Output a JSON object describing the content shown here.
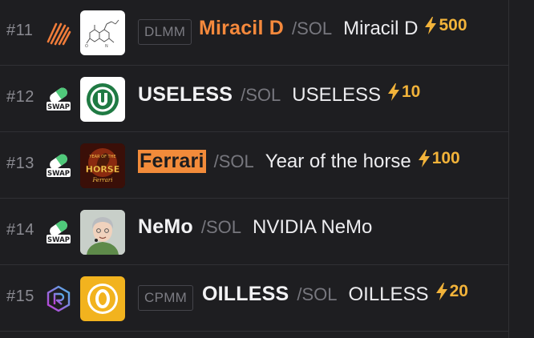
{
  "rows": [
    {
      "rank": "#11",
      "dex": "meteora",
      "pool": "DLMM",
      "symbol": "Miracil D",
      "pair": "/SOL",
      "name": "Miracil D",
      "boost": "500"
    },
    {
      "rank": "#12",
      "dex": "pumpswap",
      "dex_label": "SWAP",
      "pool": "",
      "symbol": "USELESS",
      "pair": "/SOL",
      "name": "USELESS",
      "boost": "10"
    },
    {
      "rank": "#13",
      "dex": "pumpswap",
      "dex_label": "SWAP",
      "pool": "",
      "symbol": "Ferrari",
      "pair": "/SOL",
      "name": "Year of the horse",
      "boost": "100",
      "logo_text": [
        "YEAR OF THE",
        "HORSE",
        "Ferrari"
      ]
    },
    {
      "rank": "#14",
      "dex": "pumpswap",
      "dex_label": "SWAP",
      "pool": "",
      "symbol": "NeMo",
      "pair": "/SOL",
      "name": "NVIDIA NeMo",
      "boost": ""
    },
    {
      "rank": "#15",
      "dex": "raydium",
      "pool": "CPMM",
      "symbol": "OILLESS",
      "pair": "/SOL",
      "name": "OILLESS",
      "boost": "20"
    }
  ],
  "colors": {
    "background": "#1e1e21",
    "highlight": "#f28b3a",
    "boost": "#f2b33a",
    "meteora": "#f07c3a",
    "muted": "#8b8b92"
  }
}
